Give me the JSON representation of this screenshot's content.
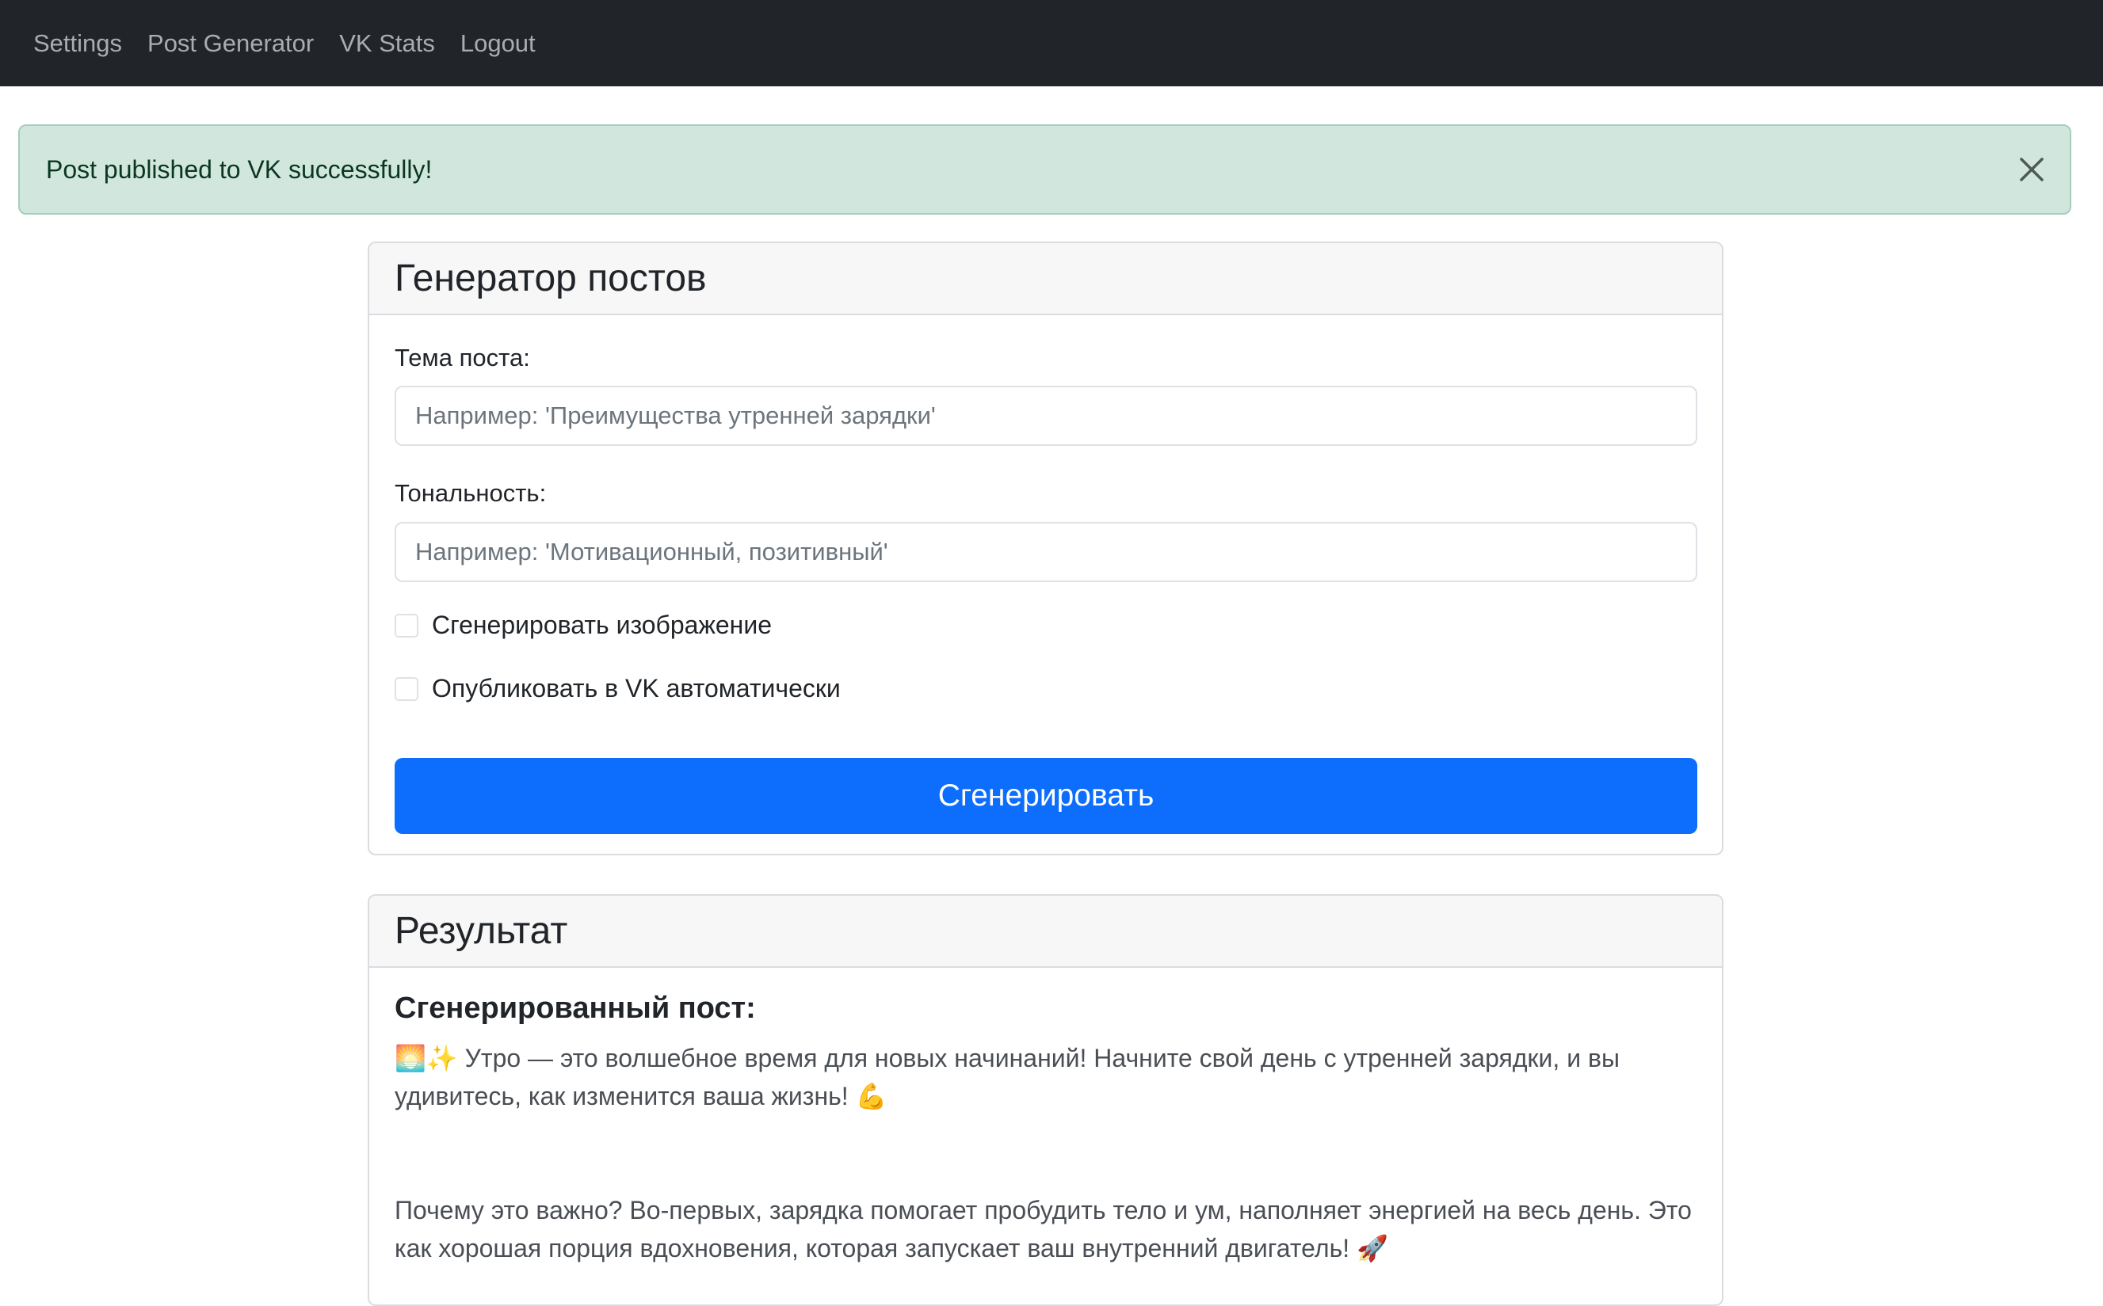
{
  "nav": {
    "items": [
      {
        "label": "Settings"
      },
      {
        "label": "Post Generator"
      },
      {
        "label": "VK Stats"
      },
      {
        "label": "Logout"
      }
    ]
  },
  "alert": {
    "message": "Post published to VK successfully!",
    "close_icon": "close-icon",
    "color_bg": "#d1e7dd",
    "color_text": "#0a3622"
  },
  "generator": {
    "title": "Генератор постов",
    "topic_label": "Тема поста:",
    "topic_value": "",
    "topic_placeholder": "Например: 'Преимущества утренней зарядки'",
    "tone_label": "Тональность:",
    "tone_value": "",
    "tone_placeholder": "Например: 'Мотивационный, позитивный'",
    "generate_image_label": "Сгенерировать изображение",
    "generate_image_checked": false,
    "auto_publish_label": "Опубликовать в VK автоматически",
    "auto_publish_checked": false,
    "submit_label": "Сгенерировать",
    "accent_color": "#0d6efd"
  },
  "result": {
    "title": "Результат",
    "subtitle": "Сгенерированный пост:",
    "paragraphs": [
      "🌅✨ Утро — это волшебное время для новых начинаний! Начните свой день с утренней зарядки, и вы удивитесь, как изменится ваша жизнь! 💪",
      "Почему это важно? Во-первых, зарядка помогает пробудить тело и ум, наполняет энергией на весь день. Это как хорошая порция вдохновения, которая запускает ваш внутренний двигатель! 🚀"
    ]
  }
}
